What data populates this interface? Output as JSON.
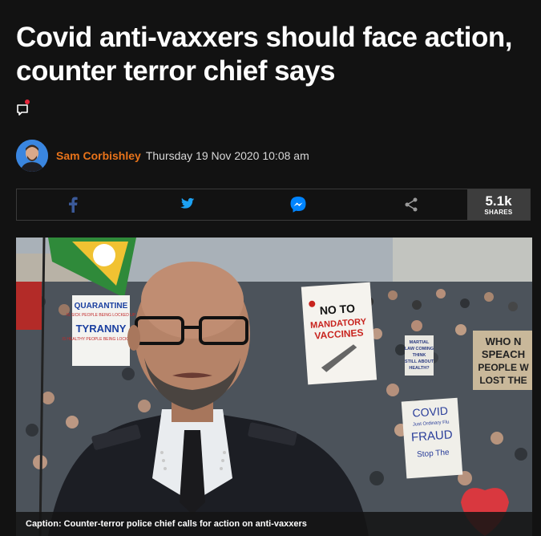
{
  "article": {
    "headline": "Covid anti-vaxxers should face action, counter terror chief says",
    "author": "Sam Corbishley",
    "date": "Thursday 19 Nov 2020 10:08 am"
  },
  "share": {
    "count": "5.1k",
    "count_label": "SHARES",
    "buttons": [
      "facebook",
      "twitter",
      "messenger",
      "share"
    ]
  },
  "image": {
    "caption": "Caption: Counter-terror police chief calls for action on anti-vaxxers",
    "signs": {
      "quarantine": "QUARANTINE",
      "quarantine_small": "IS SICK PEOPLE BEING LOCKED UP",
      "tyranny": "TYRANNY",
      "tyranny_small": "IS HEALTHY PEOPLE BEING LOCKED UP",
      "no_to": "NO TO",
      "mandatory": "MANDATORY",
      "vaccines": "VACCINES",
      "who_line1": "WHO N",
      "who_line2": "SPEACH",
      "who_line3": "PEOPLE W",
      "who_line4": "LOST THE",
      "covid": "COVID",
      "fraud_small": "Just Ordinary Flu",
      "fraud": "FRAUD",
      "stop": "Stop The",
      "martial1": "MARTIAL",
      "martial2": "LAW COMING",
      "martial3": "THINK",
      "martial4": "STILL ABOUT",
      "martial5": "HEALTH?"
    }
  },
  "colors": {
    "background": "#121212",
    "author": "#e8731a",
    "facebook": "#3b5998",
    "twitter": "#1da1f2",
    "messenger": "#0084ff",
    "notification": "#e8263b"
  }
}
